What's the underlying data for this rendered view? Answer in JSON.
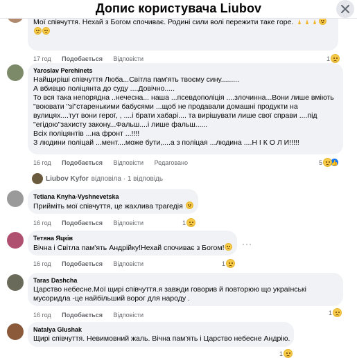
{
  "header": {
    "title": "Допис користувача Liubov"
  },
  "actions": {
    "like": "Подобається",
    "reply": "Відповісти",
    "edited": "Редаговано"
  },
  "comments": [
    {
      "author": "",
      "lines": [
        "Мої співчуття. Нехай з Богом спочиває. Родині сили волі пережити таке горе."
      ],
      "time": "17 год",
      "reactions": "1"
    },
    {
      "author": "Yaroslav Perehinets",
      "lines": [
        "Найщиріші співчуття Люба...Світла пам'ять твоєму сину.........",
        "А вбивцю поліцянта до суду ....Довічно.....",
        "То вся така непорядна ..нечесна... наша ...псевдополіція ....злочинна...Вони лише вміють",
        "\"воювати \"зі\"старенькими бабусями ...щоб не продавали домашні продукти на",
        "вулицях....тут вони герої, , ....і брати хабарі.... та вирішувати лише свої справи ....під",
        "\"егідою\"захисту закону...Фальш....і лише фальш......",
        "Всіх поліцянтів ...на фронт ...!!!!",
        "З людини поліцай ...мент....може бути,....а з поліцая ...людина ....Н І К О Л И!!!!!"
      ],
      "time": "16 год",
      "reactions": "5"
    },
    {
      "author": "Tetiana Knyha-Vyshnevetska",
      "lines": [
        "Прийміть мої співчуття, це жахлива трагедія"
      ],
      "time": "16 год",
      "reactions": "1"
    },
    {
      "author": "Тетяна Яцків",
      "lines": [
        "Вічна і Світла пам'ять Андрійку!Нехай спочиває з Богом!"
      ],
      "time": "16 год",
      "reactions": "1"
    },
    {
      "author": "Taras Dashcha",
      "lines": [
        "Царство небесне.Мої щирі співчуття.я завжди говорив й повторюю що українські",
        "мусоридла -це найбільший ворог для народу ."
      ],
      "time": "16 год",
      "reactions": "1"
    },
    {
      "author": "Natalya Glushak",
      "lines": [
        "Щирі співчуття. Невимовний жаль. Вічна пам'ять і Царство небесне Андрію."
      ],
      "time": "",
      "reactions": "1"
    }
  ],
  "reply_thread": {
    "name": "Liubov Kyfor",
    "text": "відповіла · 1 відповідь"
  },
  "colors": {
    "bubble": "#f0f2f5",
    "meta": "#65676b",
    "like_blue": "#1877f2",
    "sad_yellow": "#f7c948"
  },
  "icons": [
    "close-icon",
    "sad-reaction-icon",
    "like-reaction-icon",
    "pray-emoji-icon",
    "more-options-icon"
  ]
}
